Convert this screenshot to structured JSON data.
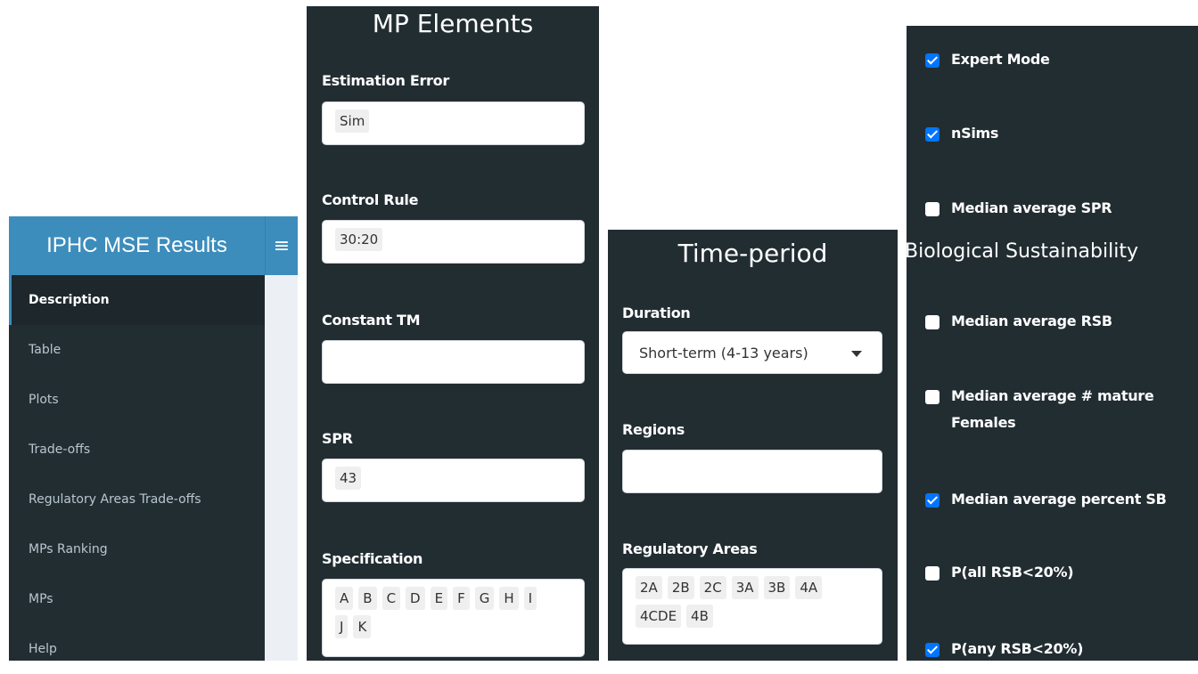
{
  "sidebar": {
    "title": "IPHC MSE Results",
    "items": [
      {
        "label": "Description",
        "active": true
      },
      {
        "label": "Table"
      },
      {
        "label": "Plots"
      },
      {
        "label": "Trade-offs"
      },
      {
        "label": "Regulatory Areas Trade-offs"
      },
      {
        "label": "MPs Ranking"
      },
      {
        "label": "MPs"
      },
      {
        "label": "Help"
      }
    ]
  },
  "mp_elements": {
    "title": "MP Elements",
    "estimation_error": {
      "label": "Estimation Error",
      "values": [
        "Sim"
      ]
    },
    "control_rule": {
      "label": "Control Rule",
      "values": [
        "30:20"
      ]
    },
    "constant_tm": {
      "label": "Constant TM",
      "values": []
    },
    "spr": {
      "label": "SPR",
      "values": [
        "43"
      ]
    },
    "specification": {
      "label": "Specification",
      "values": [
        "A",
        "B",
        "C",
        "D",
        "E",
        "F",
        "G",
        "H",
        "I",
        "J",
        "K"
      ]
    }
  },
  "time_period": {
    "title": "Time-period",
    "duration": {
      "label": "Duration",
      "value": "Short-term (4-13 years)"
    },
    "regions": {
      "label": "Regions",
      "values": []
    },
    "regulatory_areas": {
      "label": "Regulatory Areas",
      "values": [
        "2A",
        "2B",
        "2C",
        "3A",
        "3B",
        "4A",
        "4CDE",
        "4B"
      ]
    }
  },
  "options": {
    "expert_mode": {
      "label": "Expert Mode",
      "checked": true
    },
    "nsims": {
      "label": "nSims",
      "checked": true
    },
    "median_spr": {
      "label": "Median average SPR",
      "checked": false
    },
    "section_title": "Biological Sustainability",
    "median_rsb": {
      "label": "Median average RSB",
      "checked": false
    },
    "median_mature_line1": "Median average # mature",
    "median_mature_line2": "Females",
    "median_mature_checked": false,
    "median_percent_sb": {
      "label": "Median average percent SB",
      "checked": true
    },
    "p_all_rsb": {
      "label": "P(all RSB<20%)",
      "checked": false
    },
    "p_any_rsb": {
      "label": "P(any RSB<20%)",
      "checked": true
    }
  },
  "colors": {
    "sidebar_header": "#3c8dbc",
    "panel_bg": "#222d32",
    "checkbox_on": "#0075ff"
  }
}
